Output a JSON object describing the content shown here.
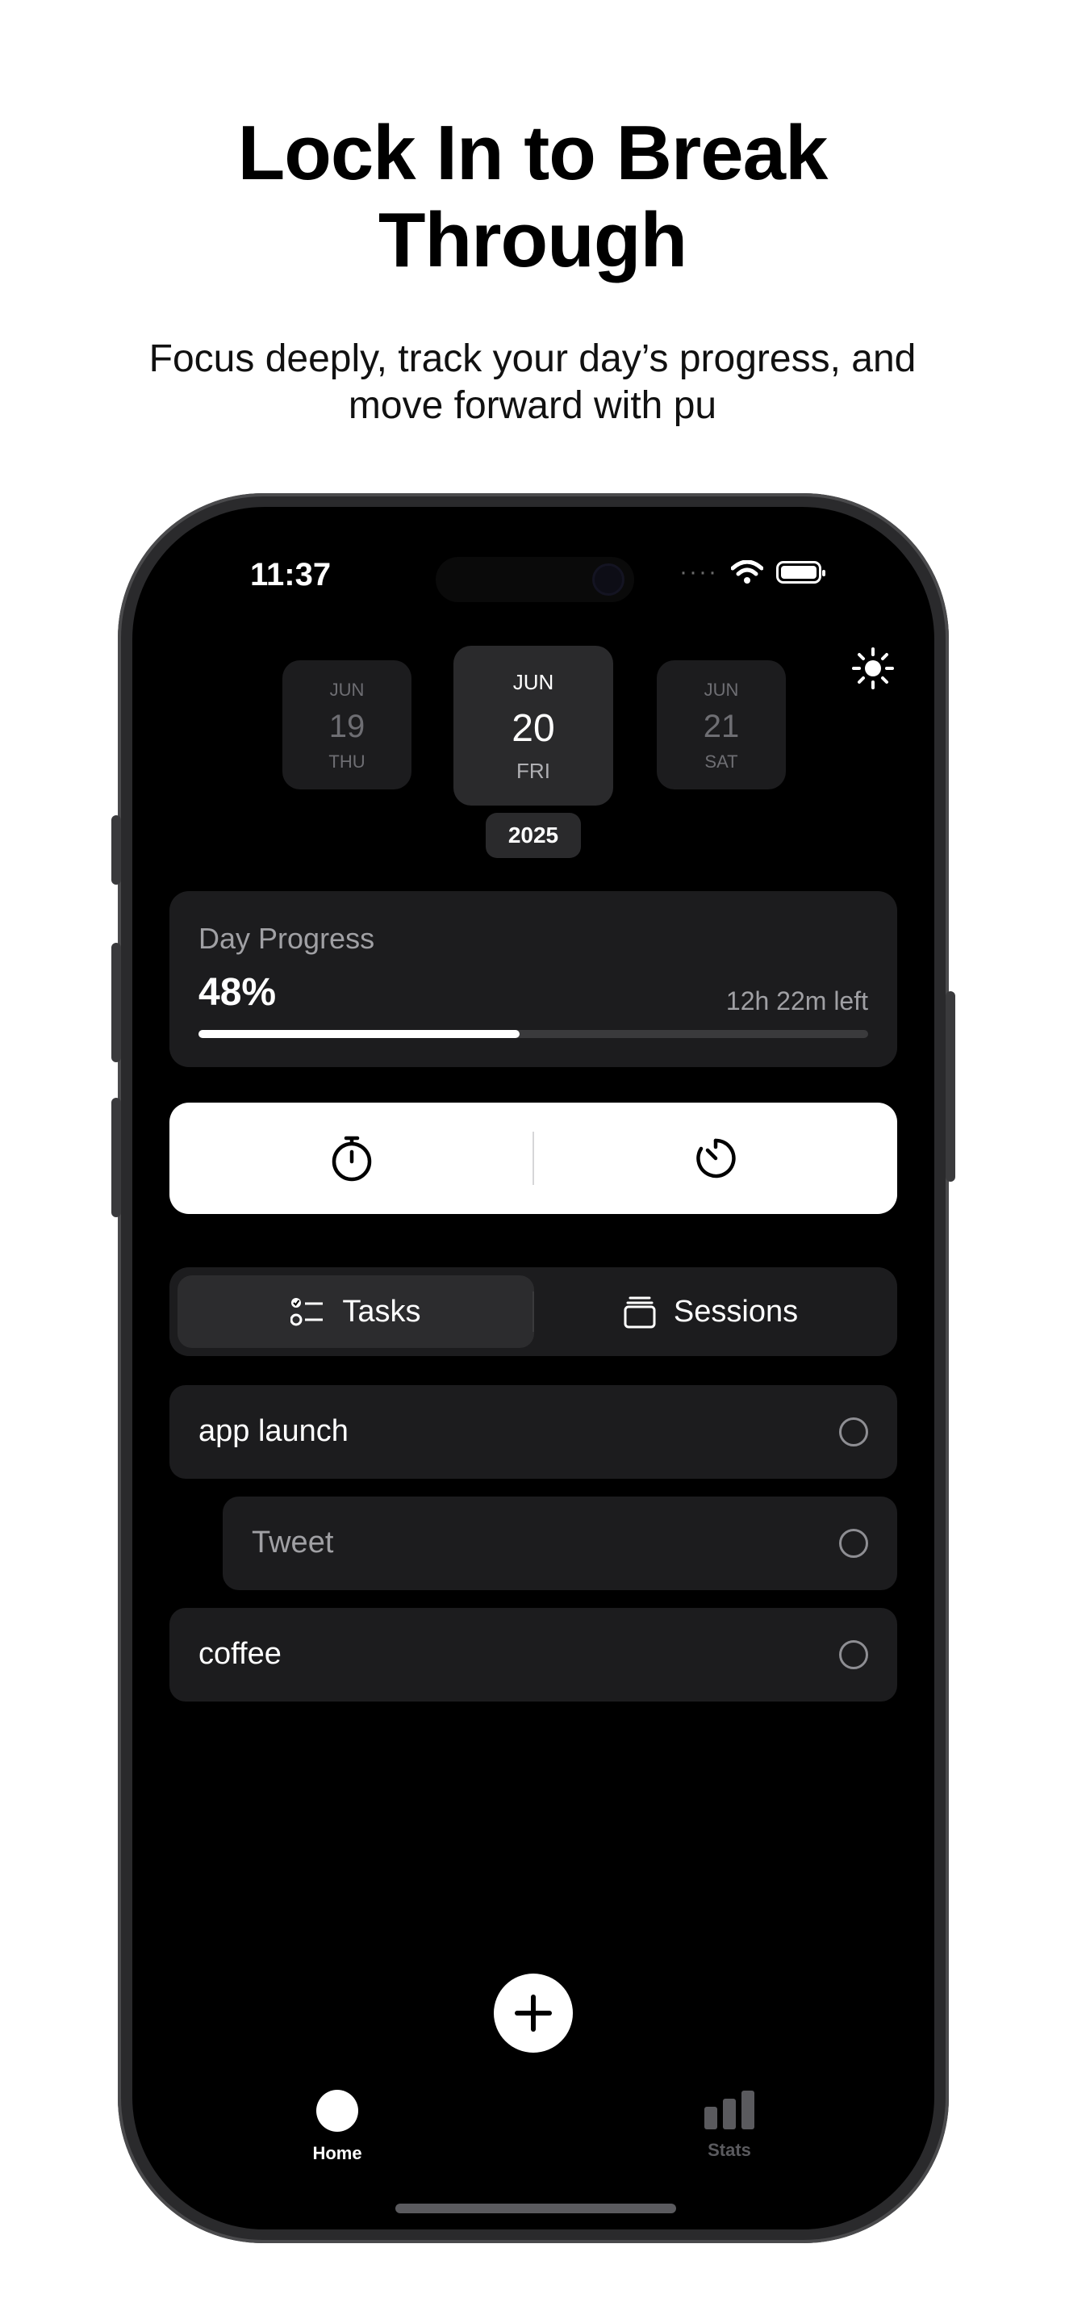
{
  "hero": {
    "title_line1": "Lock In to Break",
    "title_line2": "Through",
    "subtitle_line1": "Focus deeply, track your day’s progress, and",
    "subtitle_line2": "move forward with pu"
  },
  "status_bar": {
    "time": "11:37",
    "signal": "····"
  },
  "date_picker": {
    "days": [
      {
        "month": "JUN",
        "day": "19",
        "weekday": "THU"
      },
      {
        "month": "JUN",
        "day": "20",
        "weekday": "FRI"
      },
      {
        "month": "JUN",
        "day": "21",
        "weekday": "SAT"
      }
    ],
    "year": "2025"
  },
  "day_progress": {
    "title": "Day Progress",
    "percent_label": "48%",
    "percent": 48,
    "time_left": "12h 22m left"
  },
  "segmented": {
    "tasks_label": "Tasks",
    "sessions_label": "Sessions",
    "active": "tasks"
  },
  "tasks": [
    {
      "label": "app launch",
      "indent": false,
      "dim": false
    },
    {
      "label": "Tweet",
      "indent": true,
      "dim": true
    },
    {
      "label": "coffee",
      "indent": false,
      "dim": false
    }
  ],
  "tab_bar": {
    "home_label": "Home",
    "stats_label": "Stats"
  },
  "icons": {
    "theme": "sun-icon",
    "stopwatch": "stopwatch-icon",
    "timer": "timer-icon",
    "tasks": "checklist-icon",
    "sessions": "stack-icon",
    "add": "plus-icon",
    "home": "circle-icon",
    "stats": "bar-chart-icon"
  }
}
